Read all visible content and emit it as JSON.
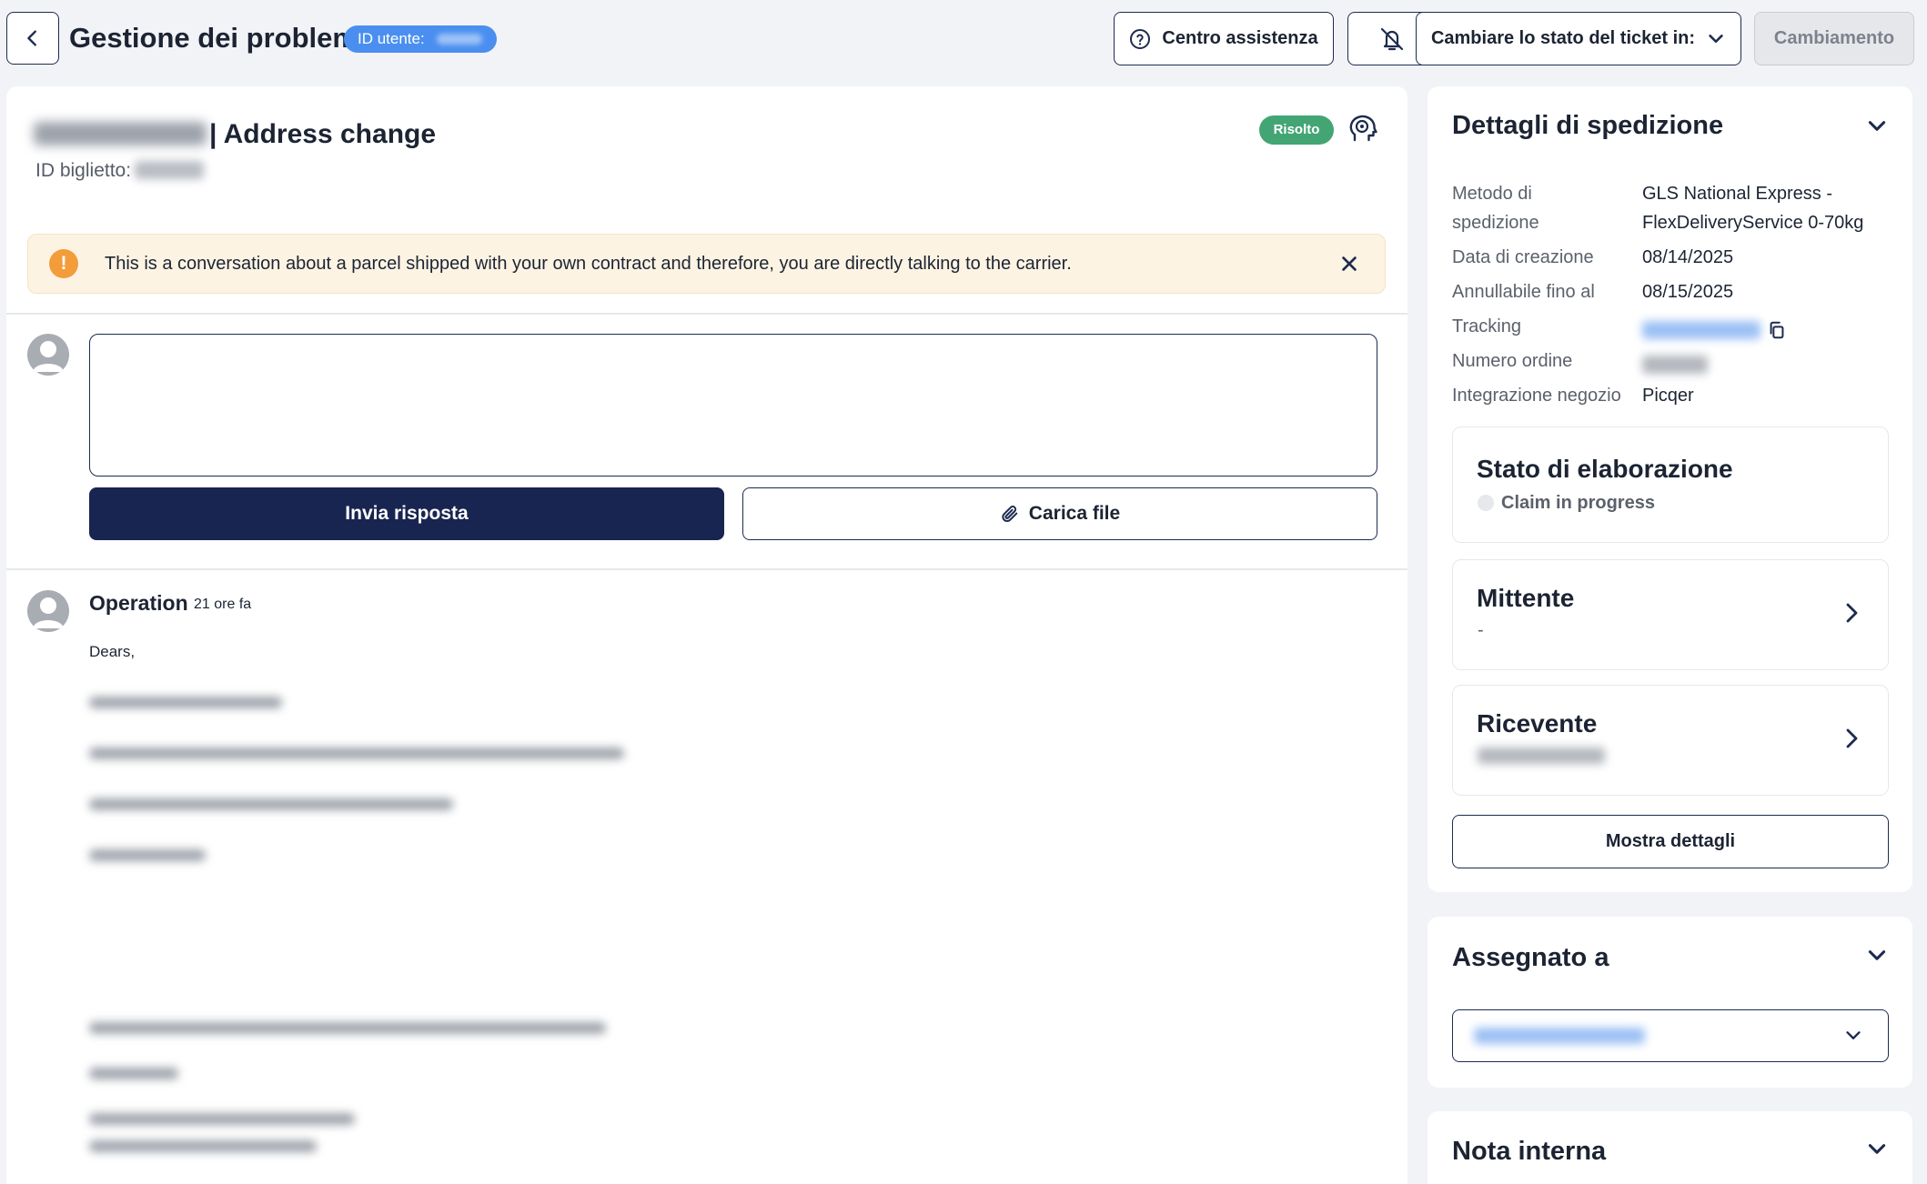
{
  "header": {
    "title": "Gestione dei problemi",
    "user_badge": "ID utente:",
    "help_label": "Centro assistenza",
    "status_label": "Cambiare lo stato del ticket in:",
    "change_label": "Cambiamento"
  },
  "ticket": {
    "subject": "| Address change",
    "id_label": "ID biglietto:",
    "status_badge": "Risolto",
    "notice": "This is a conversation about a parcel shipped with your own contract and therefore, you are directly talking to the carrier."
  },
  "reply": {
    "placeholder": "",
    "send_label": "Invia risposta",
    "upload_label": "Carica file"
  },
  "message": {
    "author": "Operation",
    "time": "21 ore fa",
    "greeting": "Dears,"
  },
  "shipment": {
    "title": "Dettagli di spedizione",
    "method_label_1": "Metodo di",
    "method_label_2": "spedizione",
    "method_value_1": "GLS National Express -",
    "method_value_2": "FlexDeliveryService 0-70kg",
    "created_label": "Data di creazione",
    "created_value": "08/14/2025",
    "cancel_label": "Annullabile fino al",
    "cancel_value": "08/15/2025",
    "tracking_label": "Tracking",
    "order_label": "Numero ordine",
    "shop_label": "Integrazione negozio",
    "shop_value": "Picqer",
    "processing_title": "Stato di elaborazione",
    "processing_status": "Claim in progress",
    "sender_title": "Mittente",
    "sender_value": "-",
    "receiver_title": "Ricevente",
    "details_label": "Mostra dettagli"
  },
  "assigned": {
    "title": "Assegnato a"
  },
  "note": {
    "title": "Nota interna"
  },
  "colors": {
    "navy": "#182550",
    "badge_blue": "#4a8ff0",
    "resolved_green": "#43a574",
    "warning_orange": "#f29d3a",
    "notice_bg": "#fdf3e3"
  },
  "icons": {
    "back": "chevron-left-icon",
    "help": "question-circle-icon",
    "mute": "bell-off-icon",
    "status_dropdown": "chevron-down-icon",
    "agent": "agent-head-icon",
    "notice": "exclamation-circle-icon",
    "close": "close-icon",
    "attach": "paperclip-icon",
    "copy": "copy-icon",
    "chevron_right": "chevron-right-icon",
    "user": "user-avatar-icon"
  }
}
